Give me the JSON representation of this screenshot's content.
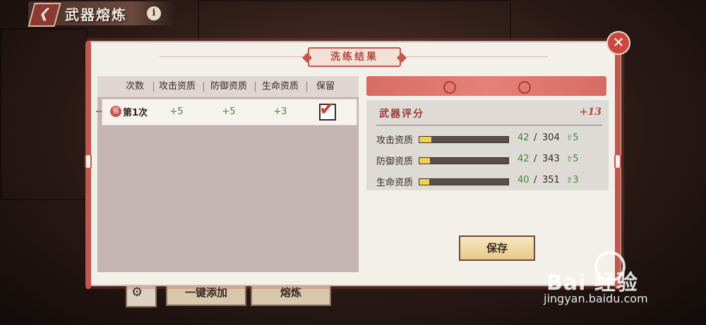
{
  "header": {
    "title": "武器熔炼",
    "info": "i"
  },
  "underlay": {
    "add_all": "一键添加",
    "smelt": "熔炼"
  },
  "dialog": {
    "title": "洗练结果",
    "close": "✕",
    "table": {
      "columns": [
        "次数",
        "攻击资质",
        "防御资质",
        "生命资质",
        "保留"
      ],
      "rows": [
        {
          "badge": "省",
          "label": "第1次",
          "attack": "+5",
          "defense": "+5",
          "life": "+3",
          "keep": true
        }
      ]
    },
    "score": {
      "label": "武器评分",
      "value": "+13"
    },
    "stats": [
      {
        "name": "攻击资质",
        "current": "42",
        "max": "304",
        "gain": "5",
        "fill": 0.138
      },
      {
        "name": "防御资质",
        "current": "42",
        "max": "343",
        "gain": "5",
        "fill": 0.122
      },
      {
        "name": "生命资质",
        "current": "40",
        "max": "351",
        "gain": "3",
        "fill": 0.114
      }
    ],
    "save": "保存"
  },
  "watermark": {
    "logo": "Bai 经验",
    "sub": "jingyan.baidu.com"
  },
  "icons": {
    "back": "back-arrow-icon",
    "settings": "gear-icon",
    "up": "up-arrow-icon",
    "close": "close-icon"
  },
  "colors": {
    "accent": "#c2574f",
    "gain": "#3d8a3a",
    "bar": "#f0d24a"
  }
}
